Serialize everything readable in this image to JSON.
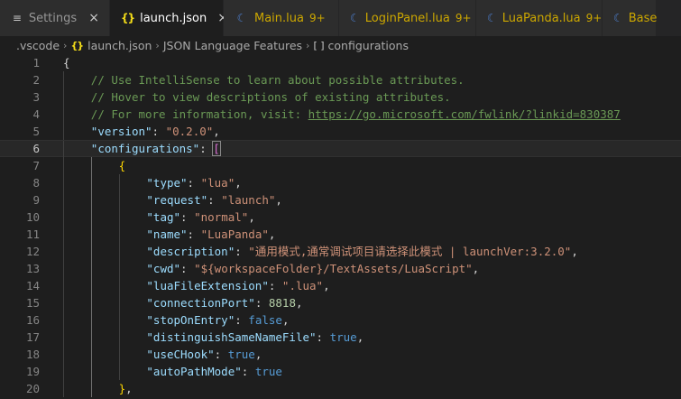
{
  "tabs": [
    {
      "icon": "settings-icon",
      "label": "Settings",
      "badge": "",
      "close": "×",
      "active": false,
      "modified": false
    },
    {
      "icon": "json-icon",
      "label": "launch.json",
      "badge": "",
      "close": "×",
      "active": true,
      "modified": false
    },
    {
      "icon": "lua-icon",
      "label": "Main.lua",
      "badge": "9+",
      "close": "",
      "active": false,
      "modified": true
    },
    {
      "icon": "lua-icon",
      "label": "LoginPanel.lua",
      "badge": "9+",
      "close": "",
      "active": false,
      "modified": true
    },
    {
      "icon": "lua-icon",
      "label": "LuaPanda.lua",
      "badge": "9+",
      "close": "",
      "active": false,
      "modified": true
    },
    {
      "icon": "lua-icon",
      "label": "Base",
      "badge": "",
      "close": "",
      "active": false,
      "modified": true
    }
  ],
  "icon_glyphs": {
    "json": "{}",
    "lua": "☾",
    "settings": "≡"
  },
  "breadcrumb": {
    "folder": ".vscode",
    "file": "launch.json",
    "section": "JSON Language Features",
    "symbol": "configurations",
    "separator": "›",
    "symbol_icon": "[ ]"
  },
  "editor": {
    "current_line": 6,
    "lines": [
      {
        "n": "1",
        "indent": 0,
        "tokens": [
          [
            "punc",
            "{"
          ]
        ]
      },
      {
        "n": "2",
        "indent": 1,
        "tokens": [
          [
            "comment",
            "// Use IntelliSense to learn about possible attributes."
          ]
        ]
      },
      {
        "n": "3",
        "indent": 1,
        "tokens": [
          [
            "comment",
            "// Hover to view descriptions of existing attributes."
          ]
        ]
      },
      {
        "n": "4",
        "indent": 1,
        "tokens": [
          [
            "comment",
            "// For more information, visit: "
          ],
          [
            "link",
            "https://go.microsoft.com/fwlink/?linkid=830387"
          ]
        ]
      },
      {
        "n": "5",
        "indent": 1,
        "tokens": [
          [
            "key",
            "\"version\""
          ],
          [
            "punc",
            ": "
          ],
          [
            "str",
            "\"0.2.0\""
          ],
          [
            "punc",
            ","
          ]
        ]
      },
      {
        "n": "6",
        "indent": 1,
        "tokens": [
          [
            "key",
            "\"configurations\""
          ],
          [
            "punc",
            ": "
          ],
          [
            "brk-hl",
            "["
          ]
        ]
      },
      {
        "n": "7",
        "indent": 2,
        "tokens": [
          [
            "brk2",
            "{"
          ]
        ]
      },
      {
        "n": "8",
        "indent": 3,
        "tokens": [
          [
            "key",
            "\"type\""
          ],
          [
            "punc",
            ": "
          ],
          [
            "str",
            "\"lua\""
          ],
          [
            "punc",
            ","
          ]
        ]
      },
      {
        "n": "9",
        "indent": 3,
        "tokens": [
          [
            "key",
            "\"request\""
          ],
          [
            "punc",
            ": "
          ],
          [
            "str",
            "\"launch\""
          ],
          [
            "punc",
            ","
          ]
        ]
      },
      {
        "n": "10",
        "indent": 3,
        "tokens": [
          [
            "key",
            "\"tag\""
          ],
          [
            "punc",
            ": "
          ],
          [
            "str",
            "\"normal\""
          ],
          [
            "punc",
            ","
          ]
        ]
      },
      {
        "n": "11",
        "indent": 3,
        "tokens": [
          [
            "key",
            "\"name\""
          ],
          [
            "punc",
            ": "
          ],
          [
            "str",
            "\"LuaPanda\""
          ],
          [
            "punc",
            ","
          ]
        ]
      },
      {
        "n": "12",
        "indent": 3,
        "tokens": [
          [
            "key",
            "\"description\""
          ],
          [
            "punc",
            ": "
          ],
          [
            "str",
            "\"通用模式,通常调试项目请选择此模式 | launchVer:3.2.0\""
          ],
          [
            "punc",
            ","
          ]
        ]
      },
      {
        "n": "13",
        "indent": 3,
        "tokens": [
          [
            "key",
            "\"cwd\""
          ],
          [
            "punc",
            ": "
          ],
          [
            "str",
            "\"${workspaceFolder}/TextAssets/LuaScript\""
          ],
          [
            "punc",
            ","
          ]
        ]
      },
      {
        "n": "14",
        "indent": 3,
        "tokens": [
          [
            "key",
            "\"luaFileExtension\""
          ],
          [
            "punc",
            ": "
          ],
          [
            "str",
            "\".lua\""
          ],
          [
            "punc",
            ","
          ]
        ]
      },
      {
        "n": "15",
        "indent": 3,
        "tokens": [
          [
            "key",
            "\"connectionPort\""
          ],
          [
            "punc",
            ": "
          ],
          [
            "num",
            "8818"
          ],
          [
            "punc",
            ","
          ]
        ]
      },
      {
        "n": "16",
        "indent": 3,
        "tokens": [
          [
            "key",
            "\"stopOnEntry\""
          ],
          [
            "punc",
            ": "
          ],
          [
            "bool",
            "false"
          ],
          [
            "punc",
            ","
          ]
        ]
      },
      {
        "n": "17",
        "indent": 3,
        "tokens": [
          [
            "key",
            "\"distinguishSameNameFile\""
          ],
          [
            "punc",
            ": "
          ],
          [
            "bool",
            "true"
          ],
          [
            "punc",
            ","
          ]
        ]
      },
      {
        "n": "18",
        "indent": 3,
        "tokens": [
          [
            "key",
            "\"useCHook\""
          ],
          [
            "punc",
            ": "
          ],
          [
            "bool",
            "true"
          ],
          [
            "punc",
            ","
          ]
        ]
      },
      {
        "n": "19",
        "indent": 3,
        "tokens": [
          [
            "key",
            "\"autoPathMode\""
          ],
          [
            "punc",
            ": "
          ],
          [
            "bool",
            "true"
          ]
        ]
      },
      {
        "n": "20",
        "indent": 2,
        "tokens": [
          [
            "brk2",
            "}"
          ],
          [
            "punc",
            ","
          ]
        ]
      }
    ]
  },
  "colors": {
    "background": "#1e1e1e",
    "tabbar": "#252526",
    "string": "#ce9178",
    "key": "#9cdcfe",
    "comment": "#6a9955",
    "boolean": "#569cd6",
    "number": "#b5cea8",
    "badge": "#cca700"
  }
}
